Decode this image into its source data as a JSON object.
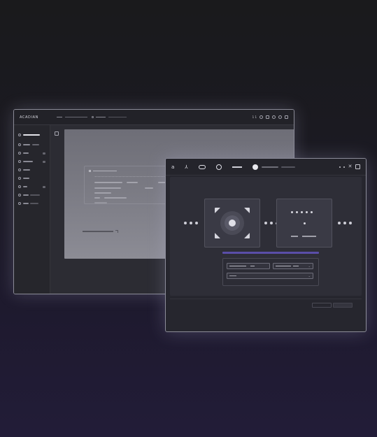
{
  "back_window": {
    "brand": "ACADIAN",
    "tabs": [
      "",
      "",
      "",
      "",
      "",
      ""
    ],
    "counter": "1 1",
    "toolbar": {
      "selector_label": ""
    },
    "sidebar": {
      "items": [
        {
          "label": "",
          "active": true
        },
        {
          "label": ""
        },
        {
          "label": ""
        },
        {
          "label": ""
        },
        {
          "label": ""
        },
        {
          "label": ""
        },
        {
          "label": ""
        },
        {
          "label": ""
        },
        {
          "label": ""
        }
      ]
    },
    "document": {
      "title": ""
    }
  },
  "front_window": {
    "logos": [
      "a",
      "⅄",
      "",
      "",
      ""
    ],
    "form": {
      "title": "",
      "fields": [
        {
          "value": "",
          "type": "input"
        },
        {
          "value": "",
          "type": "select"
        },
        {
          "value": "",
          "type": "select"
        }
      ]
    },
    "footer": {
      "back_label": "",
      "next_label": ""
    },
    "colors": {
      "accent": "#5a4ea8",
      "panel": "#26262e",
      "card": "#3a3a45"
    }
  },
  "icons": {
    "window_controls": [
      "close-icon",
      "maximize-icon"
    ],
    "toolbar": [
      "refresh-icon",
      "sync-icon",
      "share-icon"
    ]
  }
}
